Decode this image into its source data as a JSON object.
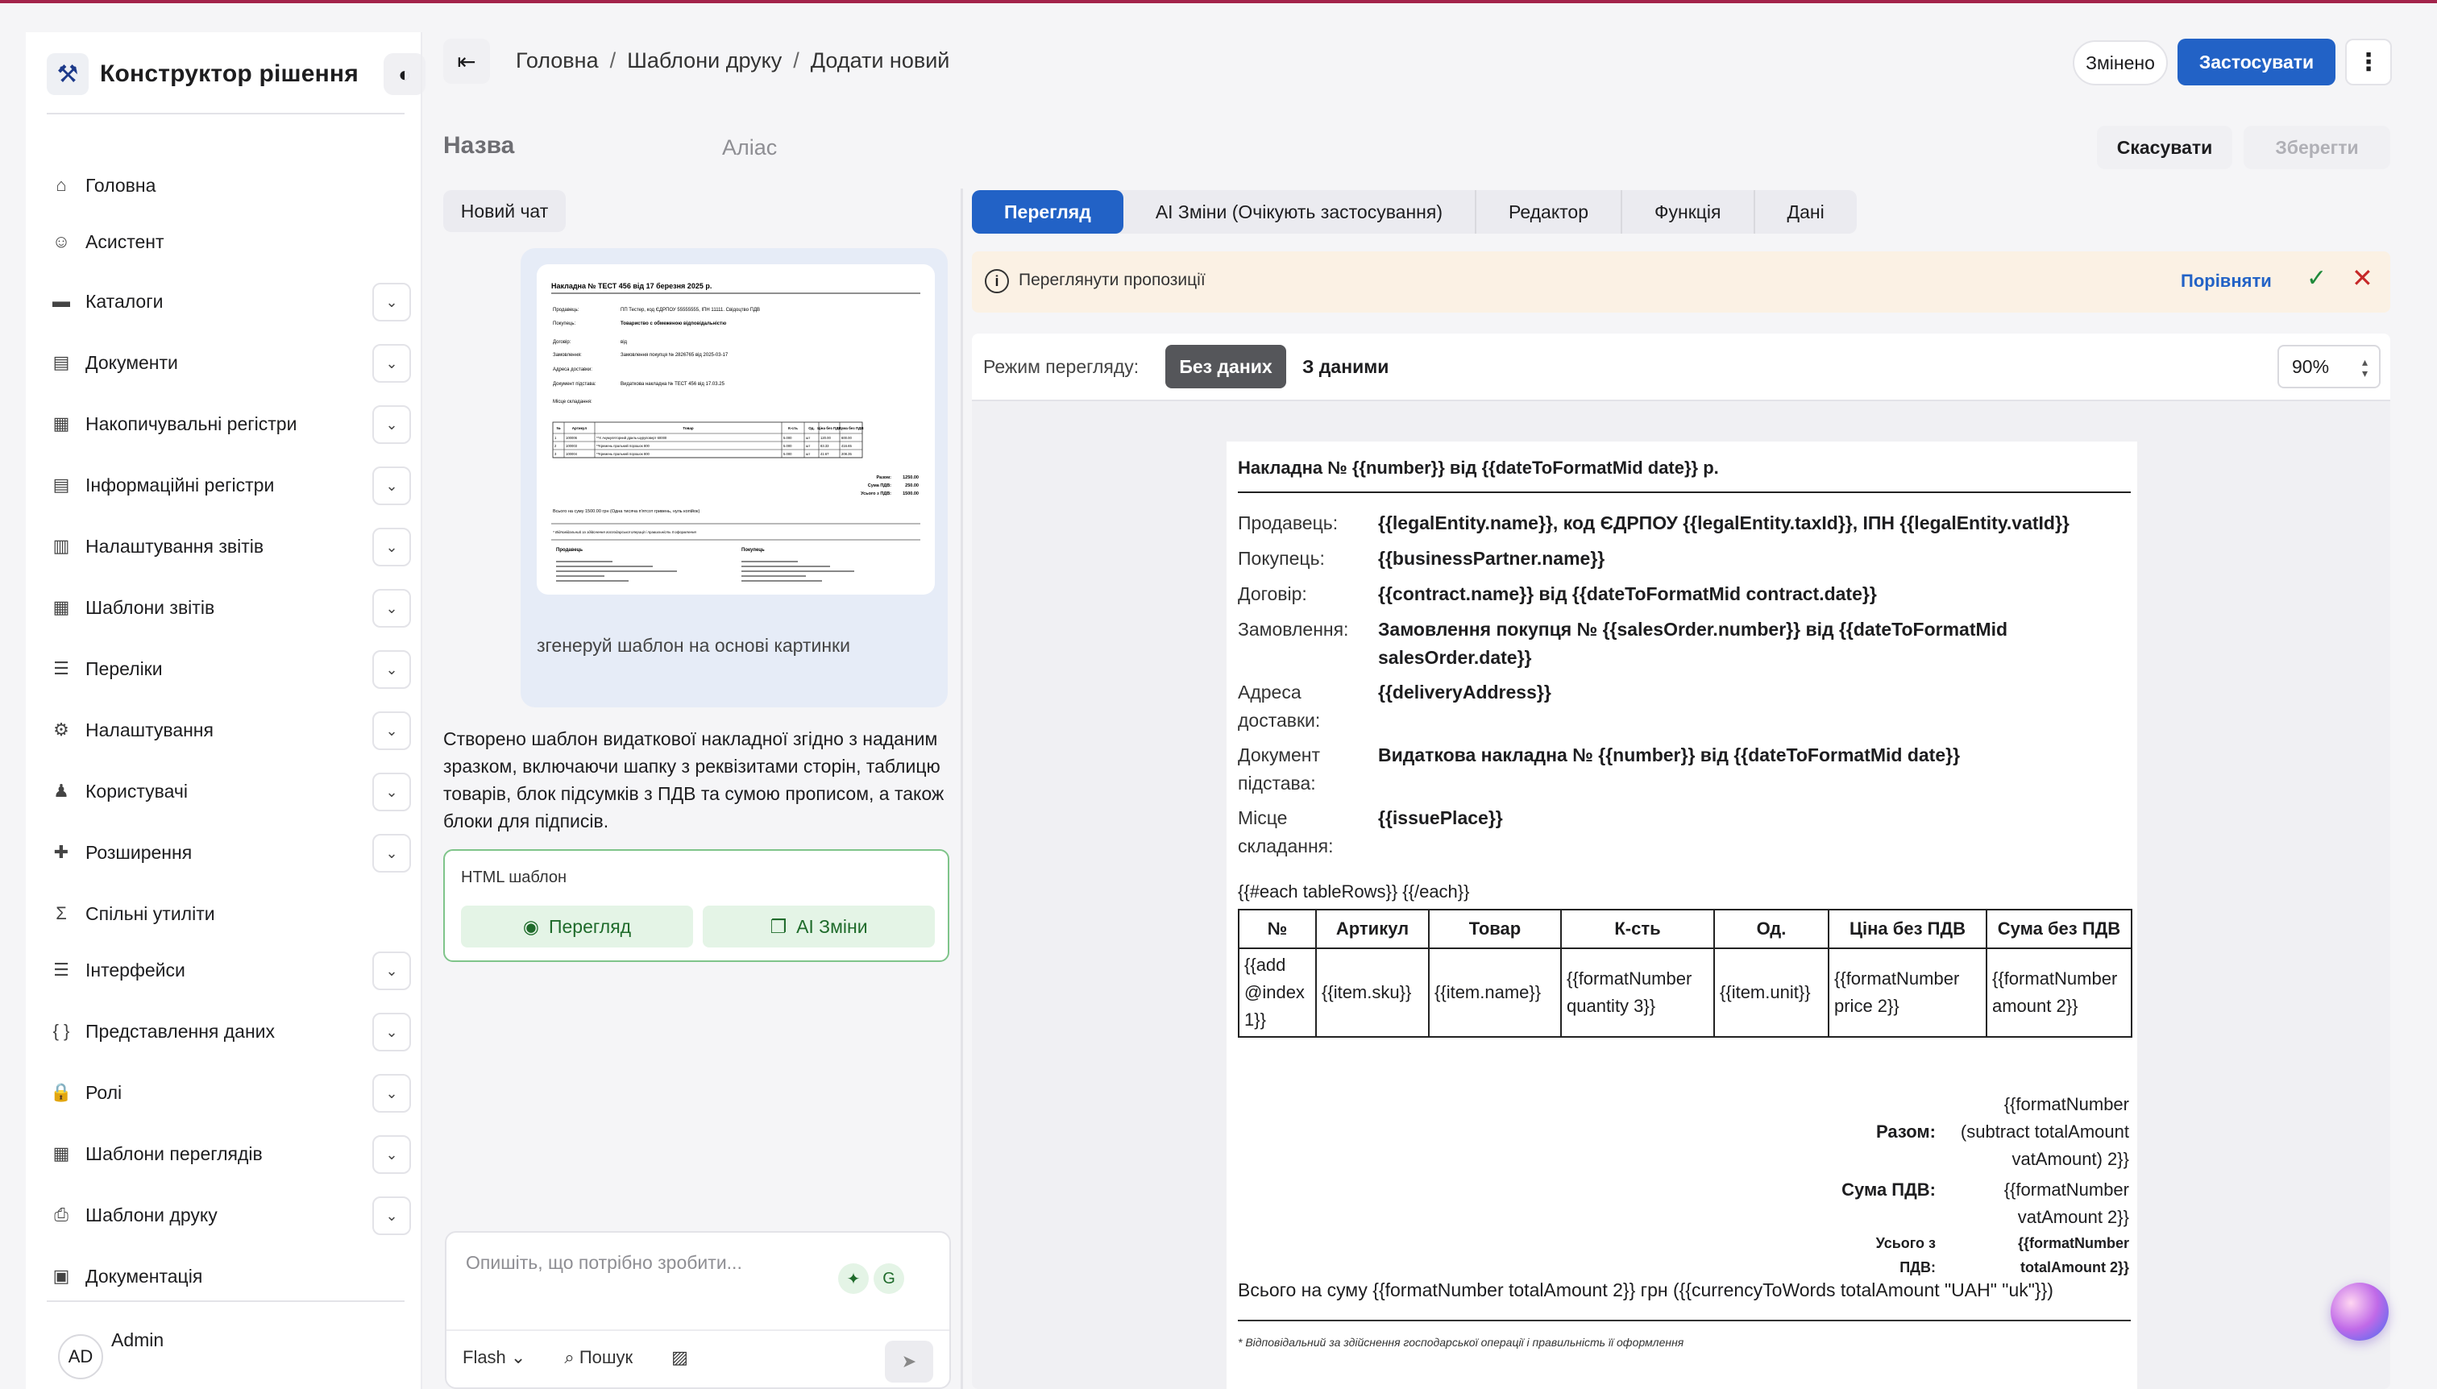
{
  "app": {
    "title": "Конструктор рішення",
    "brand_icon": "tools-icon"
  },
  "header": {
    "breadcrumbs": [
      "Головна",
      "Шаблони друку",
      "Додати новий"
    ],
    "changed_label": "Змінено",
    "apply_label": "Застосувати"
  },
  "sidebar": {
    "items": [
      {
        "label": "Головна",
        "icon": "⌂",
        "expandable": false
      },
      {
        "label": "Асистент",
        "icon": "☺",
        "expandable": false
      },
      {
        "label": "Каталоги",
        "icon": "▬",
        "expandable": true
      },
      {
        "label": "Документи",
        "icon": "▤",
        "expandable": true
      },
      {
        "label": "Накопичувальні регістри",
        "icon": "▦",
        "expandable": true
      },
      {
        "label": "Інформаційні регістри",
        "icon": "▤",
        "expandable": true
      },
      {
        "label": "Налаштування звітів",
        "icon": "▥",
        "expandable": true
      },
      {
        "label": "Шаблони звітів",
        "icon": "▦",
        "expandable": true
      },
      {
        "label": "Переліки",
        "icon": "☰",
        "expandable": true
      },
      {
        "label": "Налаштування",
        "icon": "⚙",
        "expandable": true
      },
      {
        "label": "Користувачі",
        "icon": "♟",
        "expandable": true
      },
      {
        "label": "Розширення",
        "icon": "✚",
        "expandable": true
      },
      {
        "label": "Спільні утиліти",
        "icon": "Σ",
        "expandable": false
      },
      {
        "label": "Інтерфейси",
        "icon": "☰",
        "expandable": true
      },
      {
        "label": "Представлення даних",
        "icon": "{ }",
        "expandable": true
      },
      {
        "label": "Ролі",
        "icon": "🔒",
        "expandable": true
      },
      {
        "label": "Шаблони переглядів",
        "icon": "▦",
        "expandable": true
      },
      {
        "label": "Шаблони друку",
        "icon": "⎙",
        "expandable": true
      },
      {
        "label": "Документація",
        "icon": "▣",
        "expandable": false
      }
    ],
    "user": {
      "initials": "AD",
      "name": "Admin"
    }
  },
  "form": {
    "name_label": "Назва",
    "alias_label": "Аліас",
    "cancel_label": "Скасувати",
    "save_label": "Зберегти"
  },
  "chat": {
    "new_chat_label": "Новий чат",
    "user_message": "згенеруй шаблон на основі картинки",
    "ai_message": "Створено шаблон видаткової накладної згідно з наданим зразком, включаючи шапку з реквізитами сторін, таблицю товарів, блок підсумків з ПДВ та сумою прописом, а також блоки для підписів.",
    "template_card_title": "HTML шаблон",
    "preview_btn": "Перегляд",
    "ai_changes_btn": "AI Зміни",
    "input_placeholder": "Опишіть, що потрібно зробити...",
    "model_label": "Flash",
    "search_label": "Пошук"
  },
  "preview_tabs": [
    "Перегляд",
    "AI Зміни (Очікують застосування)",
    "Редактор",
    "Функція",
    "Дані"
  ],
  "alert": {
    "text": "Переглянути пропозиції",
    "compare_label": "Порівняти"
  },
  "view_mode": {
    "label": "Режим перегляду:",
    "no_data": "Без даних",
    "with_data": "З даними",
    "zoom": "90%"
  },
  "doc": {
    "title": "Накладна № {{number}} від {{dateToFormatMid date}} р.",
    "fields": [
      {
        "label": "Продавець:",
        "value": "{{legalEntity.name}}, код ЄДРПОУ {{legalEntity.taxId}}, ІПН {{legalEntity.vatId}}"
      },
      {
        "label": "Покупець:",
        "value": "{{businessPartner.name}}"
      },
      {
        "label": "Договір:",
        "value": "{{contract.name}} від {{dateToFormatMid contract.date}}"
      },
      {
        "label": "Замовлення:",
        "value": "Замовлення покупця № {{salesOrder.number}} від {{dateToFormatMid salesOrder.date}}"
      },
      {
        "label": "Адреса доставки:",
        "value": "{{deliveryAddress}}"
      },
      {
        "label": "Документ підстава:",
        "value": "Видаткова накладна № {{number}} від {{dateToFormatMid date}}"
      },
      {
        "label": "Місце складання:",
        "value": "{{issuePlace}}"
      }
    ],
    "each_tag": "{{#each tableRows}} {{/each}}",
    "table_headers": [
      "№",
      "Артикул",
      "Товар",
      "К-сть",
      "Од.",
      "Ціна без ПДВ",
      "Сума без ПДВ"
    ],
    "table_row": [
      "{{add @index 1}}",
      "{{item.sku}}",
      "{{item.name}}",
      "{{formatNumber quantity 3}}",
      "{{item.unit}}",
      "{{formatNumber price 2}}",
      "{{formatNumber amount 2}}"
    ],
    "totals": [
      {
        "label": "Разом:",
        "value": "{{formatNumber (subtract totalAmount vatAmount) 2}}"
      },
      {
        "label": "Сума ПДВ:",
        "value": "{{formatNumber vatAmount 2}}"
      },
      {
        "label": "Усього з ПДВ:",
        "value": "{{formatNumber totalAmount 2}}"
      }
    ],
    "sum_in_words": "Всього на суму {{formatNumber totalAmount 2}} грн ({{currencyToWords totalAmount \"UAH\" \"uk\"}})",
    "footnote": "* Відповідальний за здійснення господарської операції і правильність її оформлення"
  },
  "thumbnail": {
    "title": "Накладна № ТЕСТ 456 від 17 березня 2025 р.",
    "seller_label": "Продавець:",
    "seller": "ПП Тестер, код ЄДРПОУ 55555555, ІПН 11111. Свідоцтво ПДВ",
    "buyer_label": "Покупець:",
    "buyer": "Товариство с обмеженою відповідальністю",
    "contract_label": "Договір:",
    "contract": "від",
    "order_label": "Замовлення:",
    "order": "Замовлення покупця № 2826765 від 2025-03-17",
    "address_label": "Адреса доставки:",
    "basis_label": "Документ підстава:",
    "basis": "Видаткова накладна № ТЕСТ 456 від 17.03.25",
    "place_label": "Місце складання:",
    "headers": [
      "№",
      "Артикул",
      "Товар",
      "К-сть",
      "Од.",
      "Ціна без ПДВ",
      "Сума без ПДВ"
    ],
    "rows": [
      [
        "1",
        "100006",
        "**Х Акумуляторний дриль-шуруповерт 60000",
        "5.000",
        "шт",
        "120.00",
        "600.00"
      ],
      [
        "2",
        "100003",
        "**Кремень пральний порошок 800",
        "5.000",
        "шт",
        "83.33",
        "416.65"
      ],
      [
        "3",
        "100004",
        "**Кремень пральний порошок 800",
        "5.000",
        "шт",
        "41.67",
        "208.35"
      ]
    ],
    "totals": [
      {
        "label": "Разом:",
        "value": "1250.00"
      },
      {
        "label": "Сума ПДВ:",
        "value": "250.00"
      },
      {
        "label": "Усього з ПДВ:",
        "value": "1500.00"
      }
    ],
    "sum_words": "Всього на суму 1500.00 грн (Одна тисяча п'ятсот гривень, нуль копійок)",
    "footnote": "* Відповідальний за здійснення господарської операції і правильність її оформлення",
    "seller_sign": "Продавець",
    "buyer_sign": "Покупець"
  }
}
